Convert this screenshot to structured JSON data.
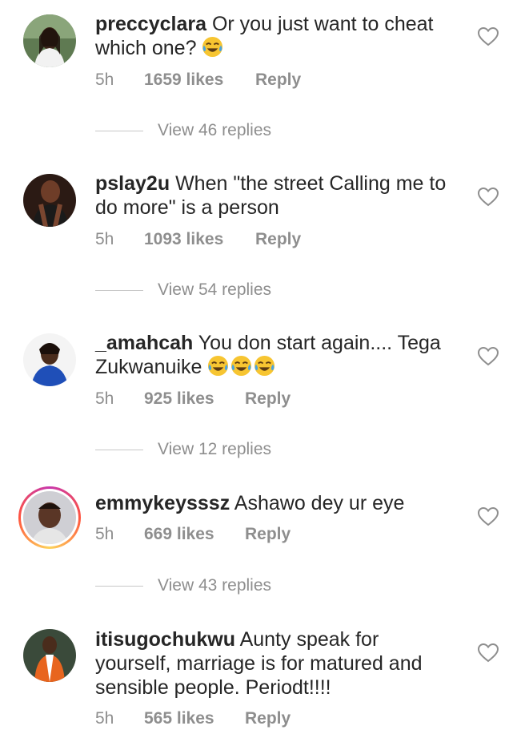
{
  "comments": [
    {
      "username": "preccyclara",
      "text": "Or you just want to cheat which one?",
      "emoji_count": 1,
      "time": "5h",
      "likes": "1659 likes",
      "reply": "Reply",
      "view_replies": "View 46 replies"
    },
    {
      "username": "pslay2u",
      "text": "When \"the street Calling me to do more\" is a person",
      "emoji_count": 0,
      "time": "5h",
      "likes": "1093 likes",
      "reply": "Reply",
      "view_replies": "View 54 replies"
    },
    {
      "username": "_amahcah",
      "text": "You don start again.... Tega Zukwanuike ",
      "emoji_count": 3,
      "time": "5h",
      "likes": "925 likes",
      "reply": "Reply",
      "view_replies": "View 12 replies"
    },
    {
      "username": "emmykeysssz",
      "text": "Ashawo dey ur eye",
      "emoji_count": 0,
      "time": "5h",
      "likes": "669 likes",
      "reply": "Reply",
      "view_replies": "View 43 replies"
    },
    {
      "username": "itisugochukwu",
      "text": "Aunty speak for yourself, marriage is for matured and sensible people. Periodt!!!!",
      "emoji_count": 0,
      "time": "5h",
      "likes": "565 likes",
      "reply": "Reply",
      "view_replies": ""
    }
  ],
  "icons": {
    "like": "heart-outline-icon",
    "emoji": "tears-of-joy-emoji"
  },
  "colors": {
    "text": "#262626",
    "meta": "#8e8e8e",
    "story_ring": "#ff543e"
  }
}
